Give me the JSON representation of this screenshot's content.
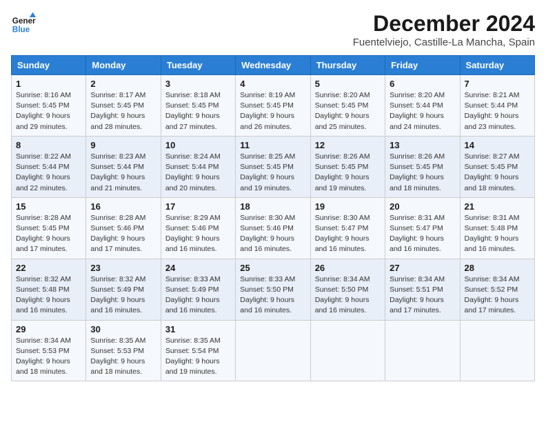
{
  "logo": {
    "text_general": "General",
    "text_blue": "Blue"
  },
  "title": "December 2024",
  "subtitle": "Fuentelviejo, Castille-La Mancha, Spain",
  "headers": [
    "Sunday",
    "Monday",
    "Tuesday",
    "Wednesday",
    "Thursday",
    "Friday",
    "Saturday"
  ],
  "weeks": [
    [
      {
        "day": "1",
        "sunrise": "Sunrise: 8:16 AM",
        "sunset": "Sunset: 5:45 PM",
        "daylight": "Daylight: 9 hours and 29 minutes."
      },
      {
        "day": "2",
        "sunrise": "Sunrise: 8:17 AM",
        "sunset": "Sunset: 5:45 PM",
        "daylight": "Daylight: 9 hours and 28 minutes."
      },
      {
        "day": "3",
        "sunrise": "Sunrise: 8:18 AM",
        "sunset": "Sunset: 5:45 PM",
        "daylight": "Daylight: 9 hours and 27 minutes."
      },
      {
        "day": "4",
        "sunrise": "Sunrise: 8:19 AM",
        "sunset": "Sunset: 5:45 PM",
        "daylight": "Daylight: 9 hours and 26 minutes."
      },
      {
        "day": "5",
        "sunrise": "Sunrise: 8:20 AM",
        "sunset": "Sunset: 5:45 PM",
        "daylight": "Daylight: 9 hours and 25 minutes."
      },
      {
        "day": "6",
        "sunrise": "Sunrise: 8:20 AM",
        "sunset": "Sunset: 5:44 PM",
        "daylight": "Daylight: 9 hours and 24 minutes."
      },
      {
        "day": "7",
        "sunrise": "Sunrise: 8:21 AM",
        "sunset": "Sunset: 5:44 PM",
        "daylight": "Daylight: 9 hours and 23 minutes."
      }
    ],
    [
      {
        "day": "8",
        "sunrise": "Sunrise: 8:22 AM",
        "sunset": "Sunset: 5:44 PM",
        "daylight": "Daylight: 9 hours and 22 minutes."
      },
      {
        "day": "9",
        "sunrise": "Sunrise: 8:23 AM",
        "sunset": "Sunset: 5:44 PM",
        "daylight": "Daylight: 9 hours and 21 minutes."
      },
      {
        "day": "10",
        "sunrise": "Sunrise: 8:24 AM",
        "sunset": "Sunset: 5:44 PM",
        "daylight": "Daylight: 9 hours and 20 minutes."
      },
      {
        "day": "11",
        "sunrise": "Sunrise: 8:25 AM",
        "sunset": "Sunset: 5:45 PM",
        "daylight": "Daylight: 9 hours and 19 minutes."
      },
      {
        "day": "12",
        "sunrise": "Sunrise: 8:26 AM",
        "sunset": "Sunset: 5:45 PM",
        "daylight": "Daylight: 9 hours and 19 minutes."
      },
      {
        "day": "13",
        "sunrise": "Sunrise: 8:26 AM",
        "sunset": "Sunset: 5:45 PM",
        "daylight": "Daylight: 9 hours and 18 minutes."
      },
      {
        "day": "14",
        "sunrise": "Sunrise: 8:27 AM",
        "sunset": "Sunset: 5:45 PM",
        "daylight": "Daylight: 9 hours and 18 minutes."
      }
    ],
    [
      {
        "day": "15",
        "sunrise": "Sunrise: 8:28 AM",
        "sunset": "Sunset: 5:45 PM",
        "daylight": "Daylight: 9 hours and 17 minutes."
      },
      {
        "day": "16",
        "sunrise": "Sunrise: 8:28 AM",
        "sunset": "Sunset: 5:46 PM",
        "daylight": "Daylight: 9 hours and 17 minutes."
      },
      {
        "day": "17",
        "sunrise": "Sunrise: 8:29 AM",
        "sunset": "Sunset: 5:46 PM",
        "daylight": "Daylight: 9 hours and 16 minutes."
      },
      {
        "day": "18",
        "sunrise": "Sunrise: 8:30 AM",
        "sunset": "Sunset: 5:46 PM",
        "daylight": "Daylight: 9 hours and 16 minutes."
      },
      {
        "day": "19",
        "sunrise": "Sunrise: 8:30 AM",
        "sunset": "Sunset: 5:47 PM",
        "daylight": "Daylight: 9 hours and 16 minutes."
      },
      {
        "day": "20",
        "sunrise": "Sunrise: 8:31 AM",
        "sunset": "Sunset: 5:47 PM",
        "daylight": "Daylight: 9 hours and 16 minutes."
      },
      {
        "day": "21",
        "sunrise": "Sunrise: 8:31 AM",
        "sunset": "Sunset: 5:48 PM",
        "daylight": "Daylight: 9 hours and 16 minutes."
      }
    ],
    [
      {
        "day": "22",
        "sunrise": "Sunrise: 8:32 AM",
        "sunset": "Sunset: 5:48 PM",
        "daylight": "Daylight: 9 hours and 16 minutes."
      },
      {
        "day": "23",
        "sunrise": "Sunrise: 8:32 AM",
        "sunset": "Sunset: 5:49 PM",
        "daylight": "Daylight: 9 hours and 16 minutes."
      },
      {
        "day": "24",
        "sunrise": "Sunrise: 8:33 AM",
        "sunset": "Sunset: 5:49 PM",
        "daylight": "Daylight: 9 hours and 16 minutes."
      },
      {
        "day": "25",
        "sunrise": "Sunrise: 8:33 AM",
        "sunset": "Sunset: 5:50 PM",
        "daylight": "Daylight: 9 hours and 16 minutes."
      },
      {
        "day": "26",
        "sunrise": "Sunrise: 8:34 AM",
        "sunset": "Sunset: 5:50 PM",
        "daylight": "Daylight: 9 hours and 16 minutes."
      },
      {
        "day": "27",
        "sunrise": "Sunrise: 8:34 AM",
        "sunset": "Sunset: 5:51 PM",
        "daylight": "Daylight: 9 hours and 17 minutes."
      },
      {
        "day": "28",
        "sunrise": "Sunrise: 8:34 AM",
        "sunset": "Sunset: 5:52 PM",
        "daylight": "Daylight: 9 hours and 17 minutes."
      }
    ],
    [
      {
        "day": "29",
        "sunrise": "Sunrise: 8:34 AM",
        "sunset": "Sunset: 5:53 PM",
        "daylight": "Daylight: 9 hours and 18 minutes."
      },
      {
        "day": "30",
        "sunrise": "Sunrise: 8:35 AM",
        "sunset": "Sunset: 5:53 PM",
        "daylight": "Daylight: 9 hours and 18 minutes."
      },
      {
        "day": "31",
        "sunrise": "Sunrise: 8:35 AM",
        "sunset": "Sunset: 5:54 PM",
        "daylight": "Daylight: 9 hours and 19 minutes."
      },
      null,
      null,
      null,
      null
    ]
  ]
}
